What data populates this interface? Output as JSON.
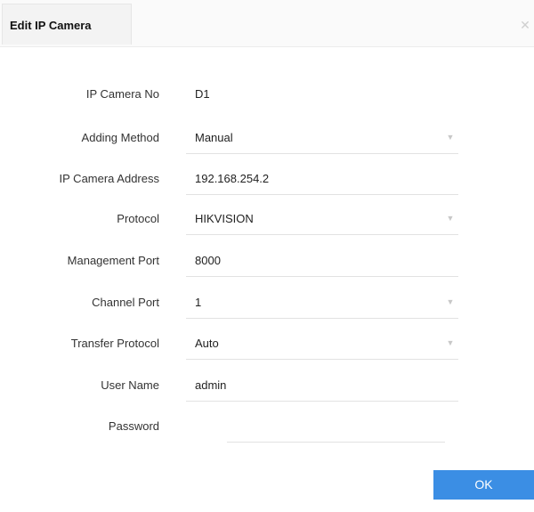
{
  "dialog": {
    "title": "Edit IP Camera",
    "close_icon": "close-icon",
    "ok_label": "OK",
    "accent_color": "#3b8ee4"
  },
  "form": {
    "camera_no": {
      "label": "IP Camera No",
      "value": "D1"
    },
    "adding_method": {
      "label": "Adding Method",
      "value": "Manual"
    },
    "ip_address": {
      "label": "IP Camera Address",
      "value": "192.168.254.2"
    },
    "protocol": {
      "label": "Protocol",
      "value": "HIKVISION"
    },
    "management_port": {
      "label": "Management Port",
      "value": "8000"
    },
    "channel_port": {
      "label": "Channel Port",
      "value": "1"
    },
    "transfer_protocol": {
      "label": "Transfer Protocol",
      "value": "Auto"
    },
    "user_name": {
      "label": "User Name",
      "value": "admin"
    },
    "password": {
      "label": "Password",
      "value": ""
    }
  }
}
